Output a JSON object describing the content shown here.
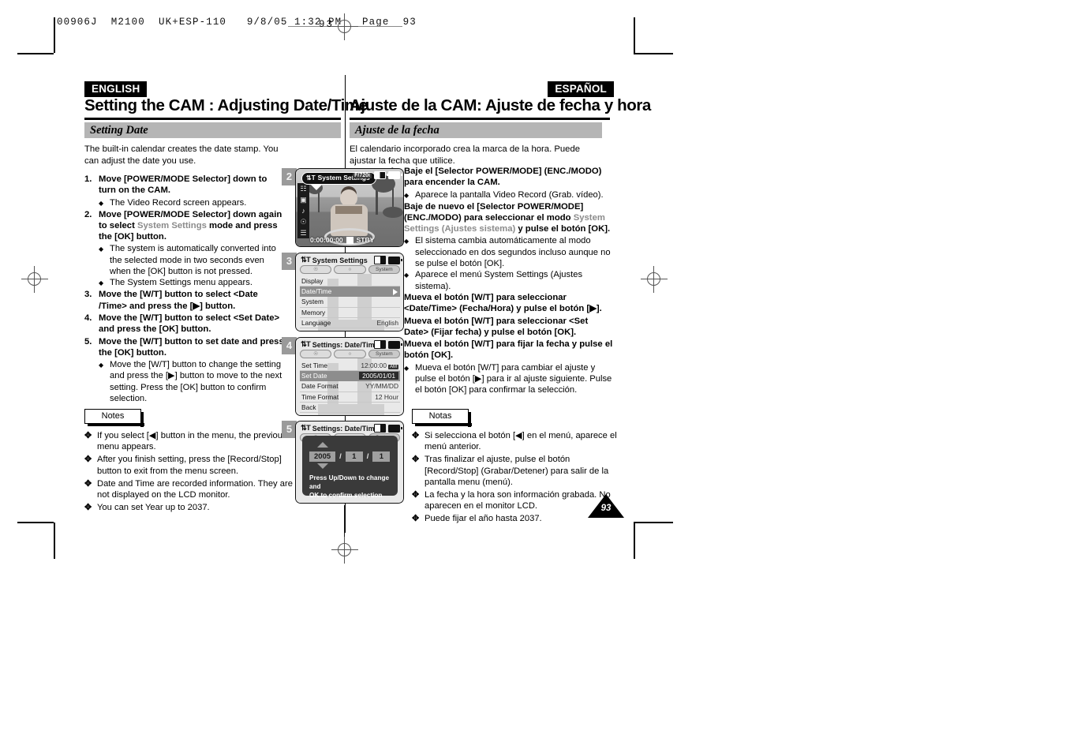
{
  "print_header": "00906J  M2100  UK+ESP-110   9/8/05 1:32 PM   Page  93",
  "corner_page_number": "93",
  "page_number": "93",
  "left_column": {
    "language_tag": "ENGLISH",
    "chapter_title": "Setting the CAM : Adjusting Date/Time",
    "section_title": "Setting Date",
    "intro": "The built-in calendar creates the date stamp. You can adjust the date you use.",
    "steps": [
      {
        "num": "1.",
        "text_before": "Move [POWER/MODE Selector] down to turn on the CAM.",
        "gray": "",
        "text_after": "",
        "subs": [
          "The Video Record screen appears."
        ]
      },
      {
        "num": "2.",
        "text_before": "Move [POWER/MODE Selector] down again to select ",
        "gray": "System Settings",
        "text_after": " mode and press the [OK] button.",
        "subs": [
          "The system is automatically converted into the selected mode in two seconds even when the [OK] button is not pressed.",
          "The System Settings menu appears."
        ]
      },
      {
        "num": "3.",
        "text_before": "Move the [W/T] button to select <Date /Time> and press the [▶] button.",
        "gray": "",
        "text_after": "",
        "subs": []
      },
      {
        "num": "4.",
        "text_before": "Move the [W/T] button to select <Set Date> and press the [OK] button.",
        "gray": "",
        "text_after": "",
        "subs": []
      },
      {
        "num": "5.",
        "text_before": "Move the [W/T] button to set date and press the [OK] button.",
        "gray": "",
        "text_after": "",
        "subs": [
          "Move the [W/T] button to change the setting and press the [▶] button to move to the next setting. Press the [OK] button to confirm selection."
        ]
      }
    ],
    "notes_label": "Notes",
    "notes": [
      "If you select [◀] button in the menu, the previous menu appears.",
      "After you finish setting, press the [Record/Stop] button to exit from the menu screen.",
      "Date and Time are recorded information. They are not displayed on the LCD monitor.",
      "You can set Year up to 2037."
    ]
  },
  "right_column": {
    "language_tag": "ESPAÑOL",
    "chapter_title": "Ajuste de la CAM: Ajuste de fecha y hora",
    "section_title": "Ajuste de la fecha",
    "intro": "El calendario incorporado crea la marca de la hora. Puede ajustar la fecha que utilice.",
    "steps": [
      {
        "num": "1.",
        "text_before": "Baje el [Selector POWER/MODE] (ENC./MODO) para encender la CAM.",
        "gray": "",
        "text_after": "",
        "subs": [
          "Aparece la pantalla Video Record (Grab. vídeo)."
        ]
      },
      {
        "num": "2.",
        "text_before": "Baje de nuevo el [Selector POWER/MODE] (ENC./MODO) para seleccionar el modo ",
        "gray": "System Settings (Ajustes sistema)",
        "text_after": " y pulse el botón [OK].",
        "subs": [
          "El sistema cambia automáticamente al modo seleccionado en dos segundos incluso aunque no se pulse el botón [OK].",
          "Aparece el menú System Settings (Ajustes sistema)."
        ]
      },
      {
        "num": "3.",
        "text_before": "Mueva el botón [W/T] para seleccionar <Date/Time> (Fecha/Hora) y pulse el botón [▶].",
        "gray": "",
        "text_after": "",
        "subs": []
      },
      {
        "num": "4.",
        "text_before": "Mueva el botón [W/T] para seleccionar <Set Date> (Fijar fecha) y pulse el botón [OK].",
        "gray": "",
        "text_after": "",
        "subs": []
      },
      {
        "num": "5.",
        "text_before": "Mueva el botón [W/T] para fijar la fecha y pulse el botón [OK].",
        "gray": "",
        "text_after": "",
        "subs": [
          "Mueva el botón [W/T] para cambiar el ajuste y pulse el botón [▶] para ir al ajuste siguiente. Pulse el botón [OK] para confirmar la selección."
        ]
      }
    ],
    "notes_label": "Notas",
    "notes": [
      "Si selecciona el botón [◀] en el menú, aparece el menú anterior.",
      "Tras finalizar el ajuste, pulse el botón [Record/Stop] (Grabar/Detener) para salir de la pantalla menu (menú).",
      "La fecha y la hora son información grabada. No aparecen en el monitor LCD.",
      "Puede fijar el año hasta 2037."
    ]
  },
  "screens": [
    {
      "badge": "2",
      "type": "video-record",
      "osd_mode": "System Settings",
      "osd_resolution": "F/720i",
      "osd_counter": "0:00:00:00",
      "osd_status": "STBY"
    },
    {
      "badge": "3",
      "type": "menu",
      "title": "System Settings",
      "tabs": [
        "",
        "",
        "System"
      ],
      "rows": [
        {
          "label": "Display",
          "value": "",
          "selected": false,
          "arrow": false
        },
        {
          "label": "Date/Time",
          "value": "",
          "selected": true,
          "arrow": true
        },
        {
          "label": "System",
          "value": "",
          "selected": false,
          "arrow": false
        },
        {
          "label": "Memory",
          "value": "",
          "selected": false,
          "arrow": false
        },
        {
          "label": "Language",
          "value": "English",
          "selected": false,
          "arrow": false
        }
      ]
    },
    {
      "badge": "4",
      "type": "menu",
      "title": "Settings: Date/Time",
      "tabs": [
        "",
        "",
        "System"
      ],
      "rows": [
        {
          "label": "Set Time",
          "value": "12:00:00",
          "ampm": "AM",
          "selected": false,
          "arrow": false
        },
        {
          "label": "Set Date",
          "value": "2005/01/01",
          "selected": true,
          "valbox": true,
          "arrow": false
        },
        {
          "label": "Date Format",
          "value": "YY/MM/DD",
          "selected": false,
          "arrow": false
        },
        {
          "label": "Time Format",
          "value": "12 Hour",
          "selected": false,
          "arrow": false
        },
        {
          "label": "Back",
          "value": "",
          "selected": false,
          "arrow": false
        }
      ]
    },
    {
      "badge": "5",
      "type": "dialog",
      "title": "Settings: Date/Time",
      "tabs": [
        "",
        "",
        "System"
      ],
      "year": "2005",
      "month": "1",
      "day": "1",
      "sep": "/",
      "hint_line1": "Press Up/Down to change and",
      "hint_line2": "OK to confirm selection"
    }
  ]
}
